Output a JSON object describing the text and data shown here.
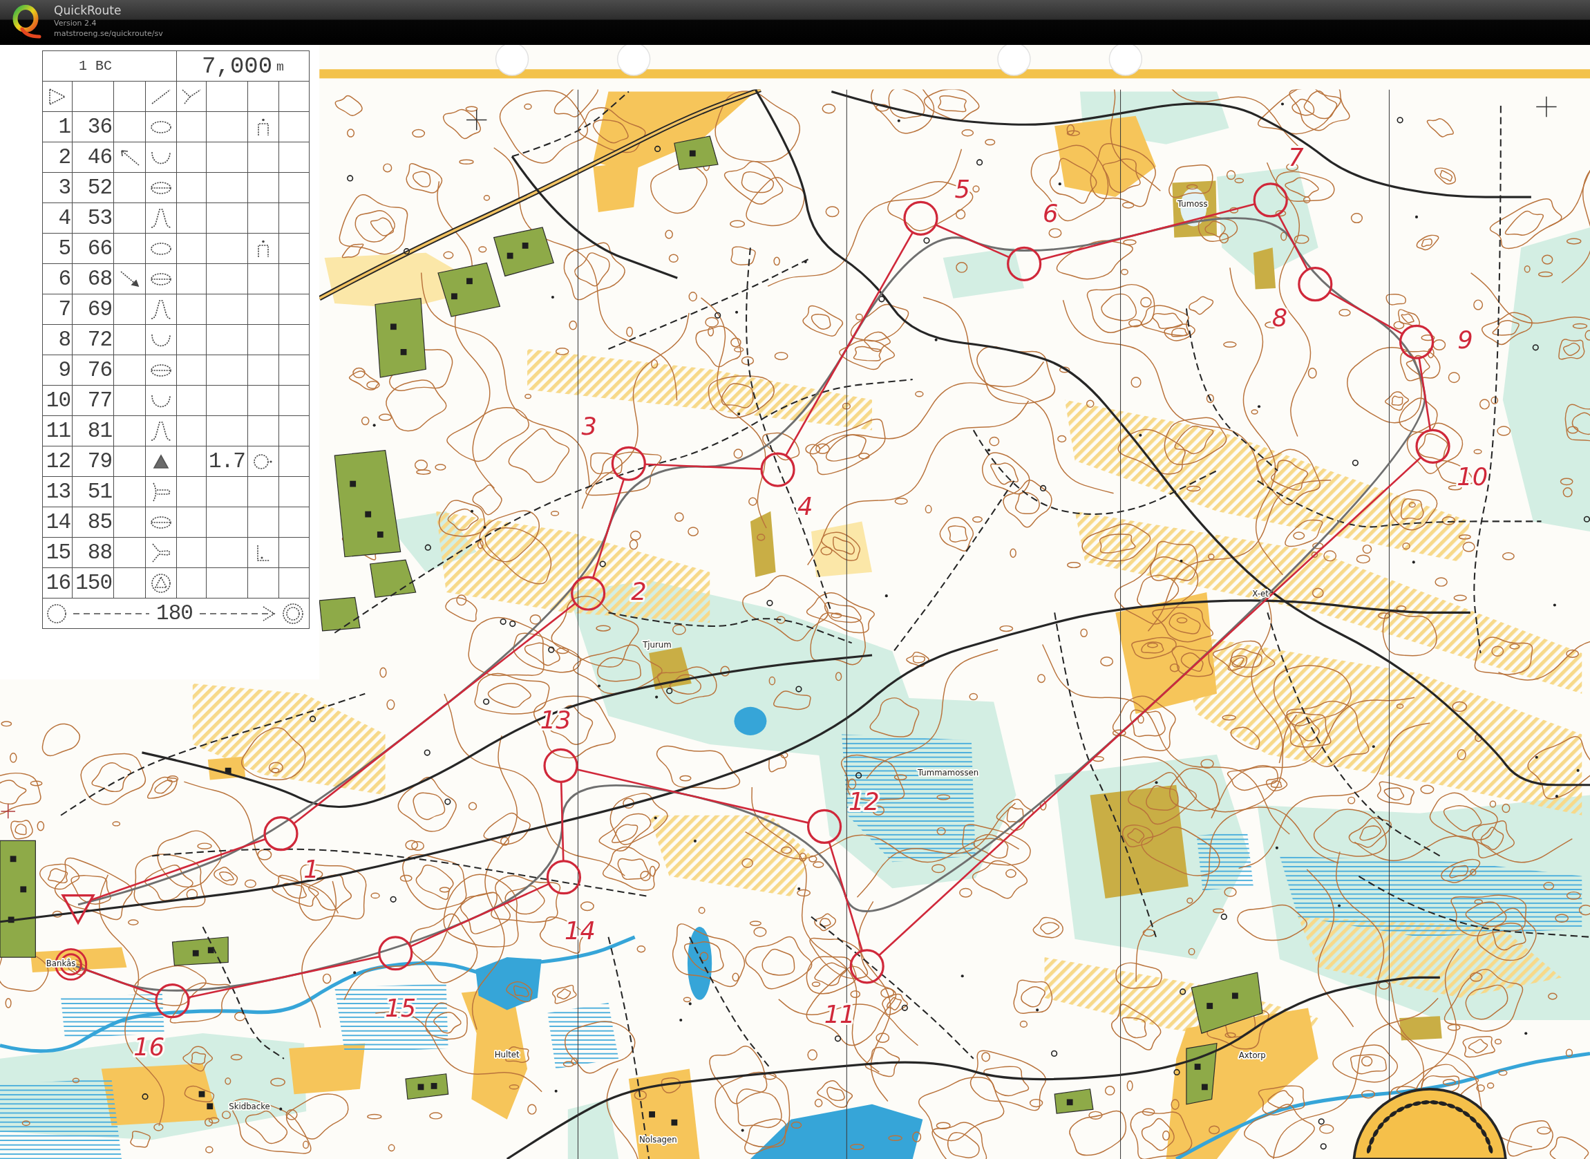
{
  "app": {
    "title": "QuickRoute",
    "version": "Version 2.4",
    "url": "matstroeng.se/quickroute/sv"
  },
  "description_sheet": {
    "course": "1 BC",
    "length": "7,000",
    "unit": "m",
    "start": {
      "kind": "path-fork"
    },
    "controls": [
      {
        "number": "1",
        "code": "36",
        "symbol": {
          "kind": "oval"
        },
        "location": {
          "kind": "arch"
        }
      },
      {
        "number": "2",
        "code": "46",
        "direction": {
          "kind": "up-left"
        },
        "symbol": {
          "kind": "cup"
        }
      },
      {
        "number": "3",
        "code": "52",
        "symbol": {
          "kind": "barred-oval"
        }
      },
      {
        "number": "4",
        "code": "53",
        "symbol": {
          "kind": "peak"
        }
      },
      {
        "number": "5",
        "code": "66",
        "symbol": {
          "kind": "oval"
        },
        "location": {
          "kind": "arch"
        }
      },
      {
        "number": "6",
        "code": "68",
        "direction": {
          "kind": "down-right"
        },
        "symbol": {
          "kind": "barred-oval"
        }
      },
      {
        "number": "7",
        "code": "69",
        "symbol": {
          "kind": "peak"
        }
      },
      {
        "number": "8",
        "code": "72",
        "symbol": {
          "kind": "cup"
        }
      },
      {
        "number": "9",
        "code": "76",
        "symbol": {
          "kind": "barred-oval"
        }
      },
      {
        "number": "10",
        "code": "77",
        "symbol": {
          "kind": "cup"
        }
      },
      {
        "number": "11",
        "code": "81",
        "symbol": {
          "kind": "peak"
        }
      },
      {
        "number": "12",
        "code": "79",
        "symbol": {
          "kind": "shaded-triangle"
        },
        "dimensions": "1.7",
        "location": {
          "kind": "ring-dot"
        }
      },
      {
        "number": "13",
        "code": "51",
        "symbol": {
          "kind": "t-branch"
        }
      },
      {
        "number": "14",
        "code": "85",
        "symbol": {
          "kind": "barred-oval"
        }
      },
      {
        "number": "15",
        "code": "88",
        "symbol": {
          "kind": "y-branch"
        },
        "location": {
          "kind": "corner"
        }
      },
      {
        "number": "16",
        "code": "150",
        "symbol": {
          "kind": "ringed-triangle"
        }
      }
    ],
    "finish": {
      "distance": "180"
    }
  },
  "map": {
    "controls": [
      {
        "label": "1"
      },
      {
        "label": "2"
      },
      {
        "label": "3"
      },
      {
        "label": "4"
      },
      {
        "label": "5"
      },
      {
        "label": "6"
      },
      {
        "label": "7"
      },
      {
        "label": "8"
      },
      {
        "label": "9"
      },
      {
        "label": "10"
      },
      {
        "label": "11"
      },
      {
        "label": "12"
      },
      {
        "label": "13"
      },
      {
        "label": "14"
      },
      {
        "label": "15"
      },
      {
        "label": "16"
      }
    ],
    "place_names": [
      {
        "name": "Tumoss"
      },
      {
        "name": "X-et"
      },
      {
        "name": "Tjurum"
      },
      {
        "name": "Tummamossen"
      },
      {
        "name": "Hultet"
      },
      {
        "name": "Skidbacke"
      },
      {
        "name": "Axtorp"
      },
      {
        "name": "Nolsagen"
      },
      {
        "name": "Bankås"
      }
    ]
  }
}
